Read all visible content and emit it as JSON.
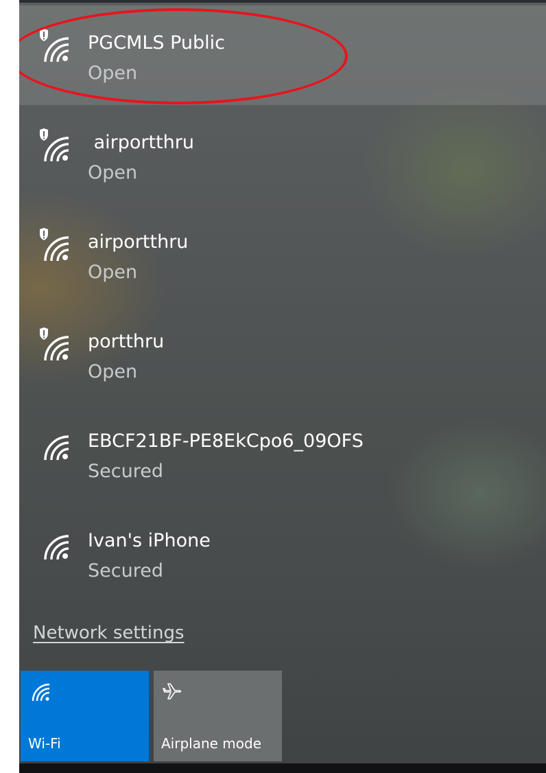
{
  "networks": [
    {
      "name": "PGCMLS Public",
      "status": "Open",
      "icon": "wifi-shield-icon"
    },
    {
      "name": " airportthru",
      "status": "Open",
      "icon": "wifi-shield-icon"
    },
    {
      "name": "airportthru",
      "status": "Open",
      "icon": "wifi-shield-icon"
    },
    {
      "name": "portthru",
      "status": "Open",
      "icon": "wifi-shield-icon"
    },
    {
      "name": "EBCF21BF-PE8EkCpo6_09OFS",
      "status": "Secured",
      "icon": "wifi-icon"
    },
    {
      "name": "Ivan's iPhone",
      "status": "Secured",
      "icon": "wifi-icon"
    }
  ],
  "network_settings_label": "Network settings",
  "quick_actions": [
    {
      "label": "Wi-Fi",
      "icon": "wifi-icon",
      "active": true
    },
    {
      "label": "Airplane mode",
      "icon": "airplane-icon",
      "active": false
    }
  ],
  "colors": {
    "accent": "#0078d7",
    "annotation": "#e8141d",
    "tile_inactive": "#6c6f70"
  }
}
